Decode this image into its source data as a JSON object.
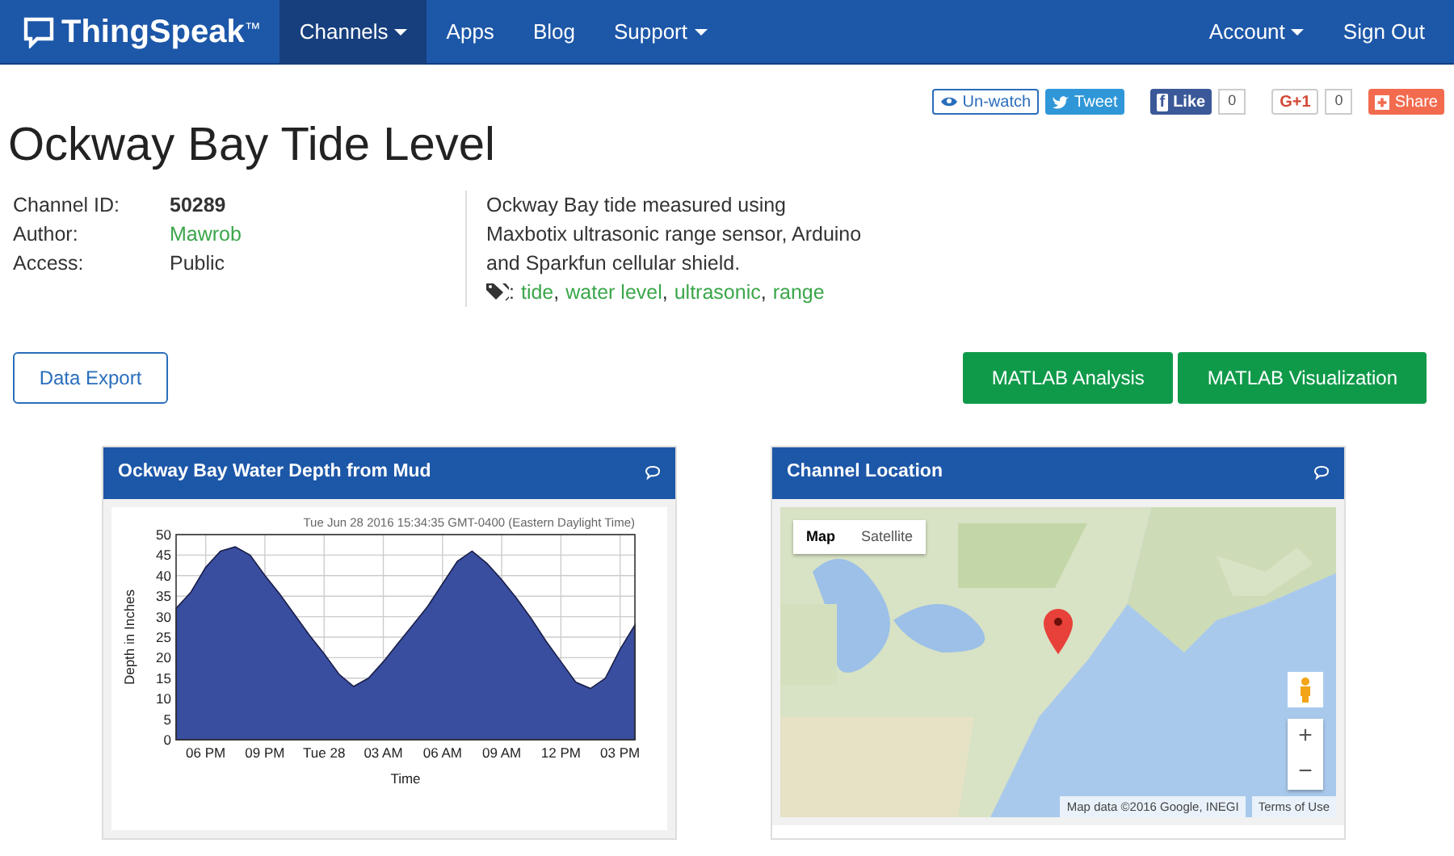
{
  "navbar": {
    "brand": "ThingSpeak",
    "trademark": "™",
    "left": [
      {
        "label": "Channels",
        "dropdown": true,
        "selected": true
      },
      {
        "label": "Apps",
        "dropdown": false,
        "selected": false
      },
      {
        "label": "Blog",
        "dropdown": false,
        "selected": false
      },
      {
        "label": "Support",
        "dropdown": true,
        "selected": false
      }
    ],
    "right": [
      {
        "label": "Account",
        "dropdown": true,
        "selected": false
      },
      {
        "label": "Sign Out",
        "dropdown": false,
        "selected": false
      }
    ]
  },
  "social": [
    {
      "kind": "watch",
      "label": "Un-watch"
    },
    {
      "kind": "tweet",
      "label": "Tweet"
    },
    {
      "kind": "like",
      "icon": "f",
      "label": "Like",
      "count": "0"
    },
    {
      "kind": "gplus",
      "label": "G+1",
      "count": "0"
    },
    {
      "kind": "share",
      "label": "Share"
    }
  ],
  "title": "Ockway Bay Tide Level",
  "fields": [
    {
      "label": "Channel ID:",
      "value": "50289",
      "kind": "bold"
    },
    {
      "label": "Author:",
      "value": "Mawrob",
      "kind": "link"
    },
    {
      "label": "Access:",
      "value": "Public",
      "kind": "plain"
    }
  ],
  "description": "Ockway Bay tide measured using Maxbotix ultrasonic range sensor, Arduino and Sparkfun cellular shield.",
  "tags_separator": ":",
  "tag_comma": ",",
  "tags": [
    "tide",
    "water level",
    "ultrasonic",
    "range"
  ],
  "actions": [
    {
      "label": "Data Export",
      "kind": "outline"
    },
    {
      "label": "MATLAB Analysis",
      "kind": "solid"
    },
    {
      "label": "MATLAB Visualization",
      "kind": "solid"
    }
  ],
  "chart_widget": {
    "title": "Ockway Bay Water Depth from Mud",
    "timestamp": "Tue Jun 28 2016 15:34:35 GMT-0400 (Eastern Daylight Time)",
    "chart_data": {
      "type": "area",
      "xlabel": "Time",
      "ylabel": "Depth in Inches",
      "categories": [
        null,
        null,
        "06 PM",
        null,
        null,
        null,
        "09 PM",
        null,
        null,
        null,
        "Tue 28",
        null,
        null,
        null,
        "03 AM",
        null,
        null,
        null,
        "06 AM",
        null,
        null,
        null,
        "09 AM",
        null,
        null,
        null,
        "12 PM",
        null,
        null,
        null,
        "03 PM",
        null
      ],
      "series": [
        {
          "color": "#3a4ea0",
          "values": [
            32,
            36,
            42,
            46,
            47,
            45,
            40,
            35.5,
            30.5,
            25.5,
            21,
            16,
            13,
            15,
            19,
            23.5,
            28,
            32.5,
            38,
            43.5,
            46,
            43,
            39,
            34.5,
            29.5,
            24,
            19,
            14,
            12.5,
            15,
            22,
            28
          ]
        }
      ],
      "ylim": [
        0,
        50
      ],
      "grid": true,
      "yticks": [
        0,
        5,
        10,
        15,
        20,
        25,
        30,
        35,
        40,
        45,
        50
      ]
    }
  },
  "map_widget": {
    "title": "Channel Location",
    "map_types": [
      {
        "label": "Map",
        "selected": true
      },
      {
        "label": "Satellite",
        "selected": false
      }
    ],
    "zoom_in": "+",
    "zoom_out": "−",
    "attribution": "Map data ©2016 Google, INEGI",
    "terms": "Terms of Use"
  }
}
